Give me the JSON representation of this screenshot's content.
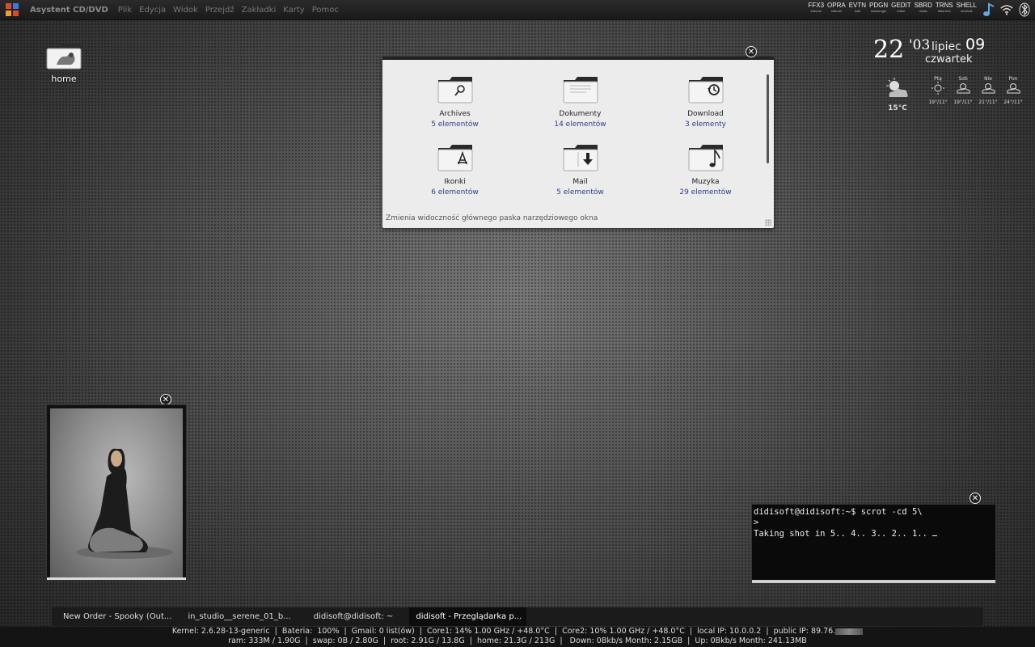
{
  "top_panel": {
    "app_title": "Asystent CD/DVD",
    "menu": [
      "Plik",
      "Edycja",
      "Widok",
      "Przejdź",
      "Zakładki",
      "Karty",
      "Pomoc"
    ],
    "logo_colors": [
      "#e04a2a",
      "#3b7be0",
      "#f0a020",
      "#e04a2a"
    ],
    "launchers": [
      {
        "name": "FFX3",
        "sub": "internet"
      },
      {
        "name": "OPRA",
        "sub": "internet"
      },
      {
        "name": "EVTN",
        "sub": "mail"
      },
      {
        "name": "PDGN",
        "sub": "messenger"
      },
      {
        "name": "GEDIT",
        "sub": "editor"
      },
      {
        "name": "SBRD",
        "sub": "music"
      },
      {
        "name": "TRNS",
        "sub": "bittorrent"
      },
      {
        "name": "SHELL",
        "sub": "terminal"
      }
    ],
    "tray": [
      "music-note-icon",
      "wifi-icon",
      "bluetooth-icon"
    ]
  },
  "desktop_icon": {
    "label": "home"
  },
  "file_manager": {
    "items": [
      {
        "name": "Archives",
        "count": "5 elementów",
        "emblem": "search"
      },
      {
        "name": "Dokumenty",
        "count": "14 elementów",
        "emblem": "doc"
      },
      {
        "name": "Download",
        "count": "3 elementy",
        "emblem": "history"
      },
      {
        "name": "Ikonki",
        "count": "6 elementów",
        "emblem": "appstore"
      },
      {
        "name": "Mail",
        "count": "5 elementów",
        "emblem": "download"
      },
      {
        "name": "Muzyka",
        "count": "29 elementów",
        "emblem": "music"
      }
    ],
    "status": "Zmienia widoczność głównego paska narzędziowego okna"
  },
  "clock": {
    "hour": "22",
    "minute": "'03",
    "month": "lipiec",
    "day": "09",
    "weekday": "czwartek"
  },
  "weather": {
    "current_temp": "15°C",
    "forecast": [
      {
        "day": "Ptą",
        "temp": "19°/11°"
      },
      {
        "day": "Sob",
        "temp": "19°/11°"
      },
      {
        "day": "Nie",
        "temp": "21°/11°"
      },
      {
        "day": "Pon",
        "temp": "24°/11°"
      }
    ]
  },
  "terminal": {
    "lines": [
      "didisoft@didisoft:~$ scrot -cd 5\\",
      ">",
      "Taking shot in 5.. 4.. 3.. 2.. 1.. "
    ]
  },
  "taskbar": {
    "tasks": [
      {
        "label": "New Order - Spooky (Out...",
        "active": false
      },
      {
        "label": "in_studio__serene_01_b...",
        "active": false
      },
      {
        "label": "didisoft@didisoft: ~",
        "active": false
      },
      {
        "label": "didisoft - Przeglądarka p...",
        "active": true
      }
    ]
  },
  "conky": {
    "row1": "Kernel: 2.6.28-13-generic  |  Bateria:  100%  |  Gmail: 0 list(ów)  |  Core1: 14% 1.00 GHz / +48.0°C  |  Core2: 10% 1.00 GHz / +48.0°C  |  local IP: 10.0.0.2  |  public IP: 89.76.",
    "row2": "ram: 333M / 1.90G  |  swap: 0B / 2.80G  |  root: 2.91G / 13.8G  |  home: 21.3G / 213G  |   Down: 0Bkb/s Month: 2.15GB  |  Up: 0Bkb/s Month: 241.13MB"
  }
}
